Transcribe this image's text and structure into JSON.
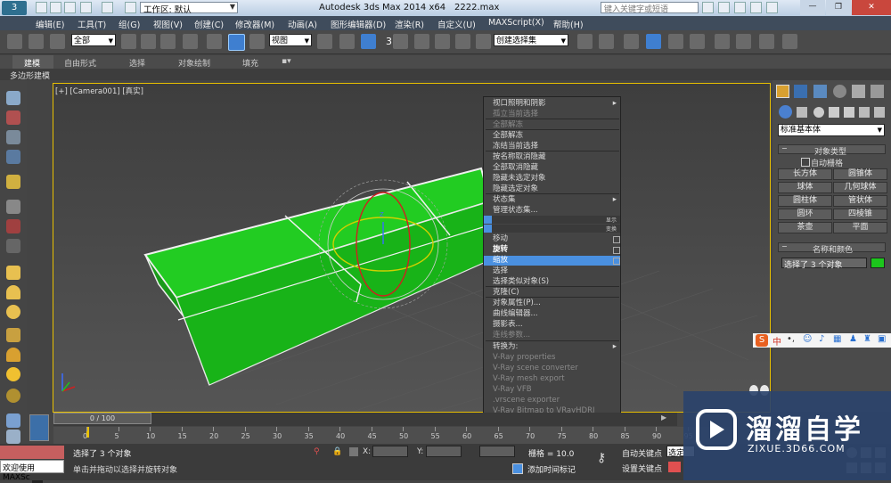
{
  "title": {
    "workspace_label": "工作区: 默认",
    "app_title": "Autodesk 3ds Max  2014 x64",
    "file_name": "2222.max",
    "search_placeholder": "键入关键字或短语"
  },
  "menu": [
    "编辑(E)",
    "工具(T)",
    "组(G)",
    "视图(V)",
    "创建(C)",
    "修改器(M)",
    "动画(A)",
    "图形编辑器(D)",
    "渲染(R)",
    "自定义(U)",
    "MAXScript(X)",
    "帮助(H)"
  ],
  "toolbar": {
    "filter_select": "全部",
    "view_select": "视图",
    "named_selection": "创建选择集",
    "snap_label": "3"
  },
  "ribbon": {
    "tabs": [
      "建模",
      "自由形式",
      "选择",
      "对象绘制",
      "填充"
    ],
    "sub_label": "多边形建模"
  },
  "viewport": {
    "label": "[+] [Camera001] [真实]",
    "gizmo_label": "Z"
  },
  "context_menu": {
    "upper": [
      {
        "label": "视口照明和阴影",
        "state": "normal",
        "arrow": true
      },
      {
        "label": "孤立当前选择",
        "state": "dim"
      },
      {
        "label": "全部解冻",
        "state": "dim"
      },
      {
        "label": "全部解冻",
        "state": "normal"
      },
      {
        "label": "冻结当前选择",
        "state": "normal"
      },
      {
        "label": "按名称取消隐藏",
        "state": "normal"
      },
      {
        "label": "全部取消隐藏",
        "state": "normal"
      },
      {
        "label": "隐藏未选定对象",
        "state": "normal"
      },
      {
        "label": "隐藏选定对象",
        "state": "normal"
      },
      {
        "label": "状态集",
        "state": "normal",
        "arrow": true
      },
      {
        "label": "管理状态集...",
        "state": "normal"
      }
    ],
    "quad_labels": [
      "显示",
      "变换"
    ],
    "lower": [
      {
        "label": "移动",
        "state": "normal"
      },
      {
        "label": "旋转",
        "state": "bold"
      },
      {
        "label": "缩放",
        "state": "highlight"
      },
      {
        "label": "选择",
        "state": "normal"
      },
      {
        "label": "选择类似对象(S)",
        "state": "normal"
      },
      {
        "label": "克隆(C)",
        "state": "normal"
      },
      {
        "label": "对象属性(P)...",
        "state": "normal"
      },
      {
        "label": "曲线编辑器...",
        "state": "normal"
      },
      {
        "label": "摄影表...",
        "state": "normal"
      },
      {
        "label": "连线参数...",
        "state": "dim"
      },
      {
        "label": "转换为:",
        "state": "normal",
        "arrow": true
      },
      {
        "label": "V-Ray properties",
        "state": "dim"
      },
      {
        "label": "V-Ray scene converter",
        "state": "dim"
      },
      {
        "label": "V-Ray mesh export",
        "state": "dim"
      },
      {
        "label": "V-Ray VFB",
        "state": "dim"
      },
      {
        "label": ".vrscene exporter",
        "state": "dim"
      },
      {
        "label": "V-Ray Bitmap to VRayHDRI converter",
        "state": "dim"
      }
    ]
  },
  "command_panel": {
    "category_select": "标准基本体",
    "rollout_object_type": "对象类型",
    "autogrid": "自动栅格",
    "primitives": [
      "长方体",
      "圆锥体",
      "球体",
      "几何球体",
      "圆柱体",
      "管状体",
      "圆环",
      "四棱锥",
      "茶壶",
      "平面"
    ],
    "rollout_name_color": "名称和颜色",
    "name_value": "选择了 3 个对象"
  },
  "timeline": {
    "frame_counter": "0 / 100",
    "ticks": [
      "0",
      "5",
      "10",
      "15",
      "20",
      "25",
      "30",
      "35",
      "40",
      "45",
      "50",
      "55",
      "60",
      "65",
      "70",
      "75",
      "80",
      "85",
      "90",
      "95"
    ]
  },
  "status": {
    "maxscript_label": "欢迎使用 MAXSc",
    "selection_text": "选择了 3 个对象",
    "prompt_text": "单击并拖动以选择并旋转对象",
    "x_label": "X:",
    "y_label": "Y:",
    "grid_text": "栅格 = 10.0",
    "auto_key": "自动关键点",
    "set_key": "设置关键点",
    "add_time_tag": "添加时间标记",
    "selected_option": "选定"
  },
  "watermark": {
    "title": "溜溜自学",
    "url": "ZIXUE.3D66.COM"
  },
  "colors": {
    "accent_blue": "#4a90e0",
    "box_green": "#1cc61c",
    "viewport_border": "#e8c000"
  }
}
